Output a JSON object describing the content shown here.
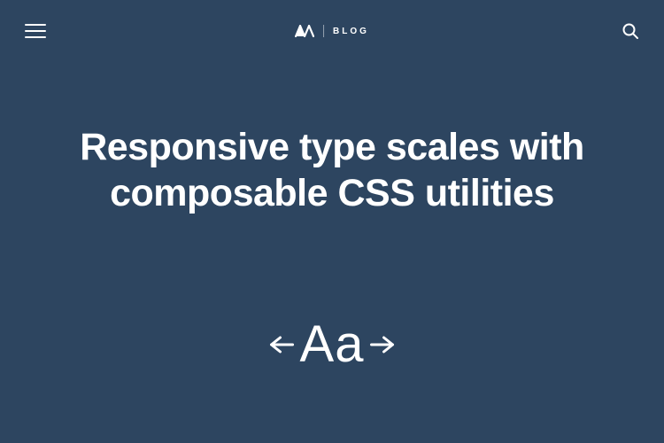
{
  "header": {
    "brand_label": "BLOG"
  },
  "hero": {
    "title": "Responsive type scales with composable CSS utilities"
  },
  "illustration": {
    "sample": "Aa"
  }
}
